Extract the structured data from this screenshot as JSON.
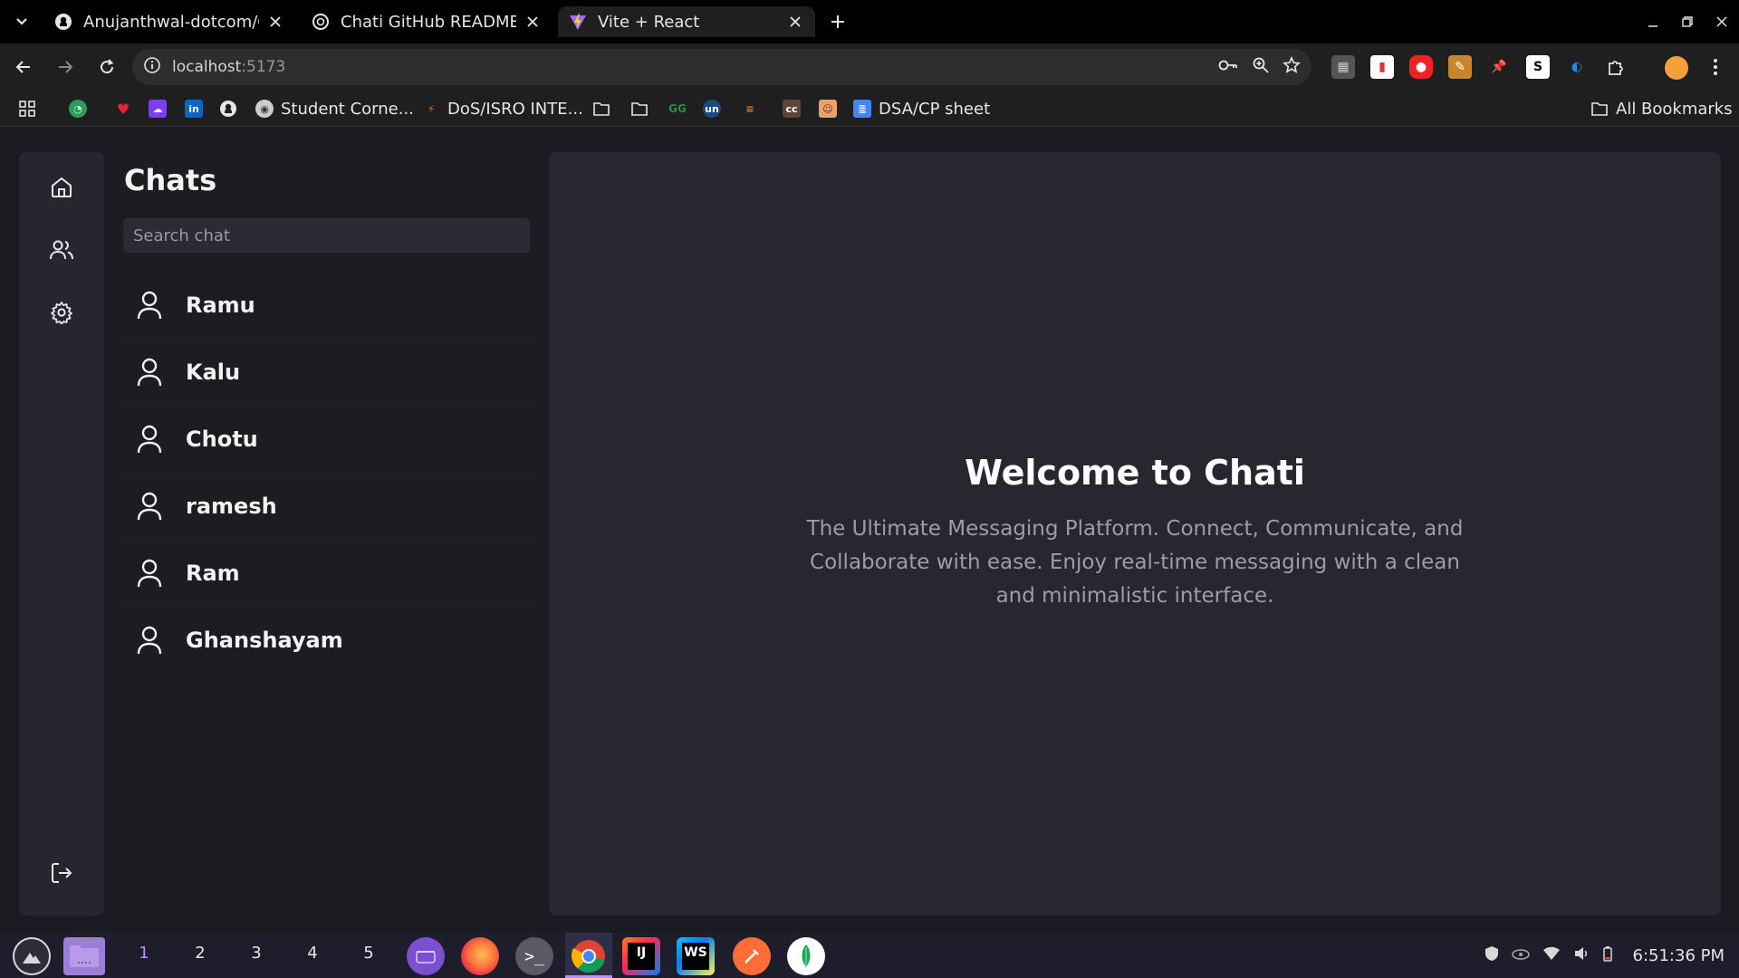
{
  "browser": {
    "tabs": [
      {
        "title": "Anujanthwal-dotcom/Ch",
        "icon": "github-icon",
        "active": false
      },
      {
        "title": "Chati GitHub README Cr",
        "icon": "chatgpt-icon",
        "active": false
      },
      {
        "title": "Vite + React",
        "icon": "vite-icon",
        "active": true
      }
    ],
    "url_host": "localhost",
    "url_port": ":5173",
    "bookmarks": [
      {
        "label": "Student Corne...",
        "icon": "globe-icon"
      },
      {
        "label": "DoS/ISRO INTE...",
        "icon": "isro-icon"
      },
      {
        "label": "DSA/CP sheet",
        "icon": "doc-icon"
      }
    ],
    "all_bookmarks_label": "All Bookmarks"
  },
  "app": {
    "sidebar_icons": [
      "home-icon",
      "users-icon",
      "settings-icon"
    ],
    "logout_icon": "logout-icon",
    "chats_title": "Chats",
    "search_placeholder": "Search chat",
    "chats": [
      {
        "name": "Ramu"
      },
      {
        "name": "Kalu"
      },
      {
        "name": "Chotu"
      },
      {
        "name": "ramesh"
      },
      {
        "name": "Ram"
      },
      {
        "name": "Ghanshayam"
      }
    ],
    "welcome_title": "Welcome to Chati",
    "welcome_subtitle": "The Ultimate Messaging Platform. Connect, Communicate, and Collaborate with ease. Enjoy real-time messaging with a clean and minimalistic interface."
  },
  "taskbar": {
    "workspaces": [
      "1",
      "2",
      "3",
      "4",
      "5"
    ],
    "active_workspace": "1",
    "clock": "6:51:36 PM"
  },
  "colors": {
    "accent": "#b592ff",
    "background": "#1b1b22",
    "panel": "#27272f"
  }
}
